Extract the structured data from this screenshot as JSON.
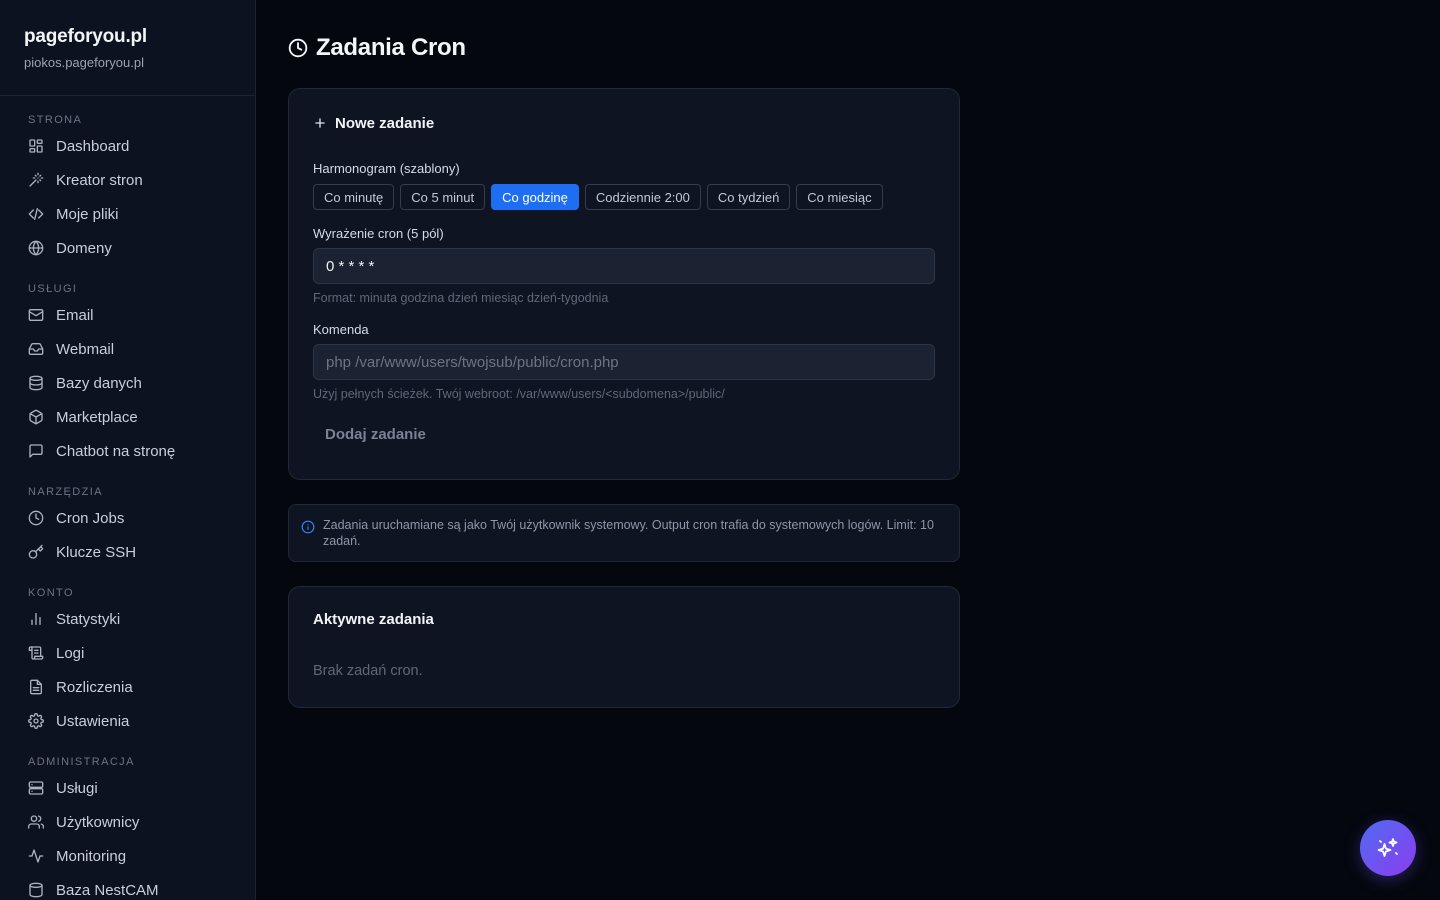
{
  "brand": {
    "title": "pageforyou.pl",
    "subtitle": "piokos.pageforyou.pl"
  },
  "sidebar": {
    "sections": [
      {
        "label": "STRONA",
        "items": [
          "Dashboard",
          "Kreator stron",
          "Moje pliki",
          "Domeny"
        ]
      },
      {
        "label": "USŁUGI",
        "items": [
          "Email",
          "Webmail",
          "Bazy danych",
          "Marketplace",
          "Chatbot na stronę"
        ]
      },
      {
        "label": "NARZĘDZIA",
        "items": [
          "Cron Jobs",
          "Klucze SSH"
        ]
      },
      {
        "label": "KONTO",
        "items": [
          "Statystyki",
          "Logi",
          "Rozliczenia",
          "Ustawienia"
        ]
      },
      {
        "label": "ADMINISTRACJA",
        "items": [
          "Usługi",
          "Użytkownicy",
          "Monitoring",
          "Baza NestCAM"
        ]
      }
    ]
  },
  "page": {
    "title": "Zadania Cron"
  },
  "new_job": {
    "title": "Nowe zadanie",
    "schedule_label": "Harmonogram (szablony)",
    "templates": [
      "Co minutę",
      "Co 5 minut",
      "Co godzinę",
      "Codziennie 2:00",
      "Co tydzień",
      "Co miesiąc"
    ],
    "selected_template": "Co godzinę",
    "cron_label": "Wyrażenie cron (5 pól)",
    "cron_value": "0 * * * *",
    "cron_hint": "Format: minuta godzina dzień miesiąc dzień-tygodnia",
    "command_label": "Komenda",
    "command_placeholder": "php /var/www/users/twojsub/public/cron.php",
    "command_hint": "Użyj pełnych ścieżek. Twój webroot: /var/www/users/<subdomena>/public/",
    "submit_label": "Dodaj zadanie"
  },
  "info": {
    "text": "Zadania uruchamiane są jako Twój użytkownik systemowy. Output cron trafia do systemowych logów. Limit: 10 zadań."
  },
  "active_jobs": {
    "title": "Aktywne zadania",
    "empty_text": "Brak zadań cron."
  },
  "colors": {
    "accent": "#1d6ef2",
    "background": "#05070e",
    "sidebar": "#0c1220",
    "card": "#0e1422"
  }
}
